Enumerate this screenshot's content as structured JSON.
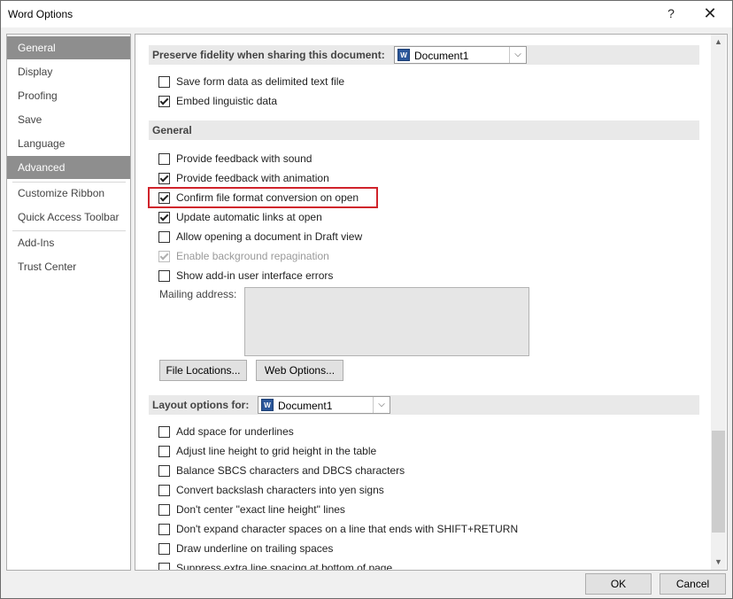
{
  "window": {
    "title": "Word Options",
    "help_glyph": "?",
    "close_glyph": "✕"
  },
  "nav": {
    "items": [
      {
        "label": "General",
        "selected": true
      },
      {
        "label": "Display"
      },
      {
        "label": "Proofing"
      },
      {
        "label": "Save"
      },
      {
        "label": "Language"
      },
      {
        "label": "Advanced",
        "selected": true
      },
      {
        "label": "Customize Ribbon"
      },
      {
        "label": "Quick Access Toolbar"
      },
      {
        "label": "Add-Ins"
      },
      {
        "label": "Trust Center"
      }
    ]
  },
  "preserve": {
    "label": "Preserve fidelity when sharing this document:",
    "document": "Document1",
    "options": [
      {
        "label": "Save form data as delimited text file",
        "checked": false
      },
      {
        "label": "Embed linguistic data",
        "checked": true
      }
    ]
  },
  "general": {
    "label": "General",
    "options": [
      {
        "label": "Provide feedback with sound",
        "checked": false
      },
      {
        "label": "Provide feedback with animation",
        "checked": true
      },
      {
        "label": "Confirm file format conversion on open",
        "checked": true,
        "highlighted": true
      },
      {
        "label": "Update automatic links at open",
        "checked": true
      },
      {
        "label": "Allow opening a document in Draft view",
        "checked": false
      },
      {
        "label": "Enable background repagination",
        "checked": true,
        "disabled": true
      },
      {
        "label": "Show add-in user interface errors",
        "checked": false
      }
    ],
    "mailing_label": "Mailing address:",
    "file_locations_label": "File Locations...",
    "web_options_label": "Web Options..."
  },
  "layout": {
    "label": "Layout options for:",
    "document": "Document1",
    "options": [
      {
        "label": "Add space for underlines",
        "checked": false
      },
      {
        "label": "Adjust line height to grid height in the table",
        "checked": false
      },
      {
        "label": "Balance SBCS characters and DBCS characters",
        "checked": false
      },
      {
        "label": "Convert backslash characters into yen signs",
        "checked": false
      },
      {
        "label": "Don't center \"exact line height\" lines",
        "checked": false
      },
      {
        "label": "Don't expand character spaces on a line that ends with SHIFT+RETURN",
        "checked": false
      },
      {
        "label": "Draw underline on trailing spaces",
        "checked": false
      },
      {
        "label": "Suppress extra line spacing at bottom of page",
        "checked": false
      }
    ]
  },
  "footer": {
    "ok_label": "OK",
    "cancel_label": "Cancel"
  },
  "icons": {
    "doc_icon": "word-document-icon",
    "doc_icon_glyph": "W",
    "dropdown_glyph": "⌵",
    "up_glyph": "▲",
    "down_glyph": "▼"
  },
  "colors": {
    "highlight": "#d0232b",
    "selected_nav": "#8e8e8e"
  }
}
